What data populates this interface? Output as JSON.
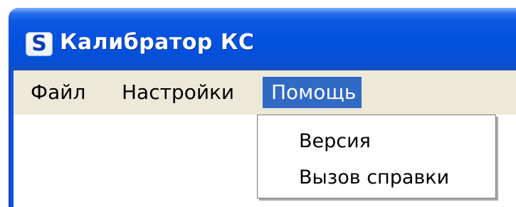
{
  "window": {
    "title": "Калибратор КС",
    "icon_letter": "S",
    "icon": "app-s-icon"
  },
  "menubar": {
    "items": [
      {
        "label": "Файл"
      },
      {
        "label": "Настройки"
      },
      {
        "label": "Помощь",
        "state": "open"
      }
    ]
  },
  "dropdown": {
    "items": [
      {
        "label": "Версия"
      },
      {
        "label": "Вызов справки"
      }
    ]
  },
  "colors": {
    "titlebar": "#0552e0",
    "menubar": "#ece9d8",
    "menu_highlight": "#316ac5",
    "title_text": "#ffffff"
  }
}
